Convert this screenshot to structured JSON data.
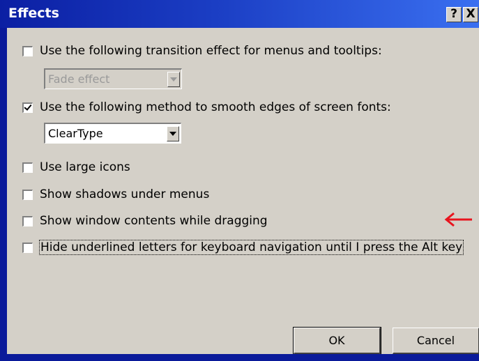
{
  "window": {
    "title": "Effects",
    "help_label": "?",
    "close_label": "X"
  },
  "options": [
    {
      "label": "Use the following transition effect for menus and tooltips:",
      "checked": false
    },
    {
      "label": "Use the following method to smooth edges of screen fonts:",
      "checked": true
    },
    {
      "label": "Use large icons",
      "checked": false
    },
    {
      "label": "Show shadows under menus",
      "checked": false
    },
    {
      "label": "Show window contents while dragging",
      "checked": false
    },
    {
      "label": "Hide underlined letters for keyboard navigation until I press the Alt key",
      "checked": false
    }
  ],
  "transition_select": {
    "value": "Fade effect",
    "enabled": false
  },
  "smoothing_select": {
    "value": "ClearType",
    "enabled": true
  },
  "buttons": {
    "ok": "OK",
    "cancel": "Cancel"
  },
  "annotation": {
    "arrow_color": "#e8141e",
    "icon": "red-arrow-icon"
  },
  "colors": {
    "title_start": "#0b1fa3",
    "title_end": "#3a6ff0",
    "dialog_bg": "#d4d0c8"
  }
}
